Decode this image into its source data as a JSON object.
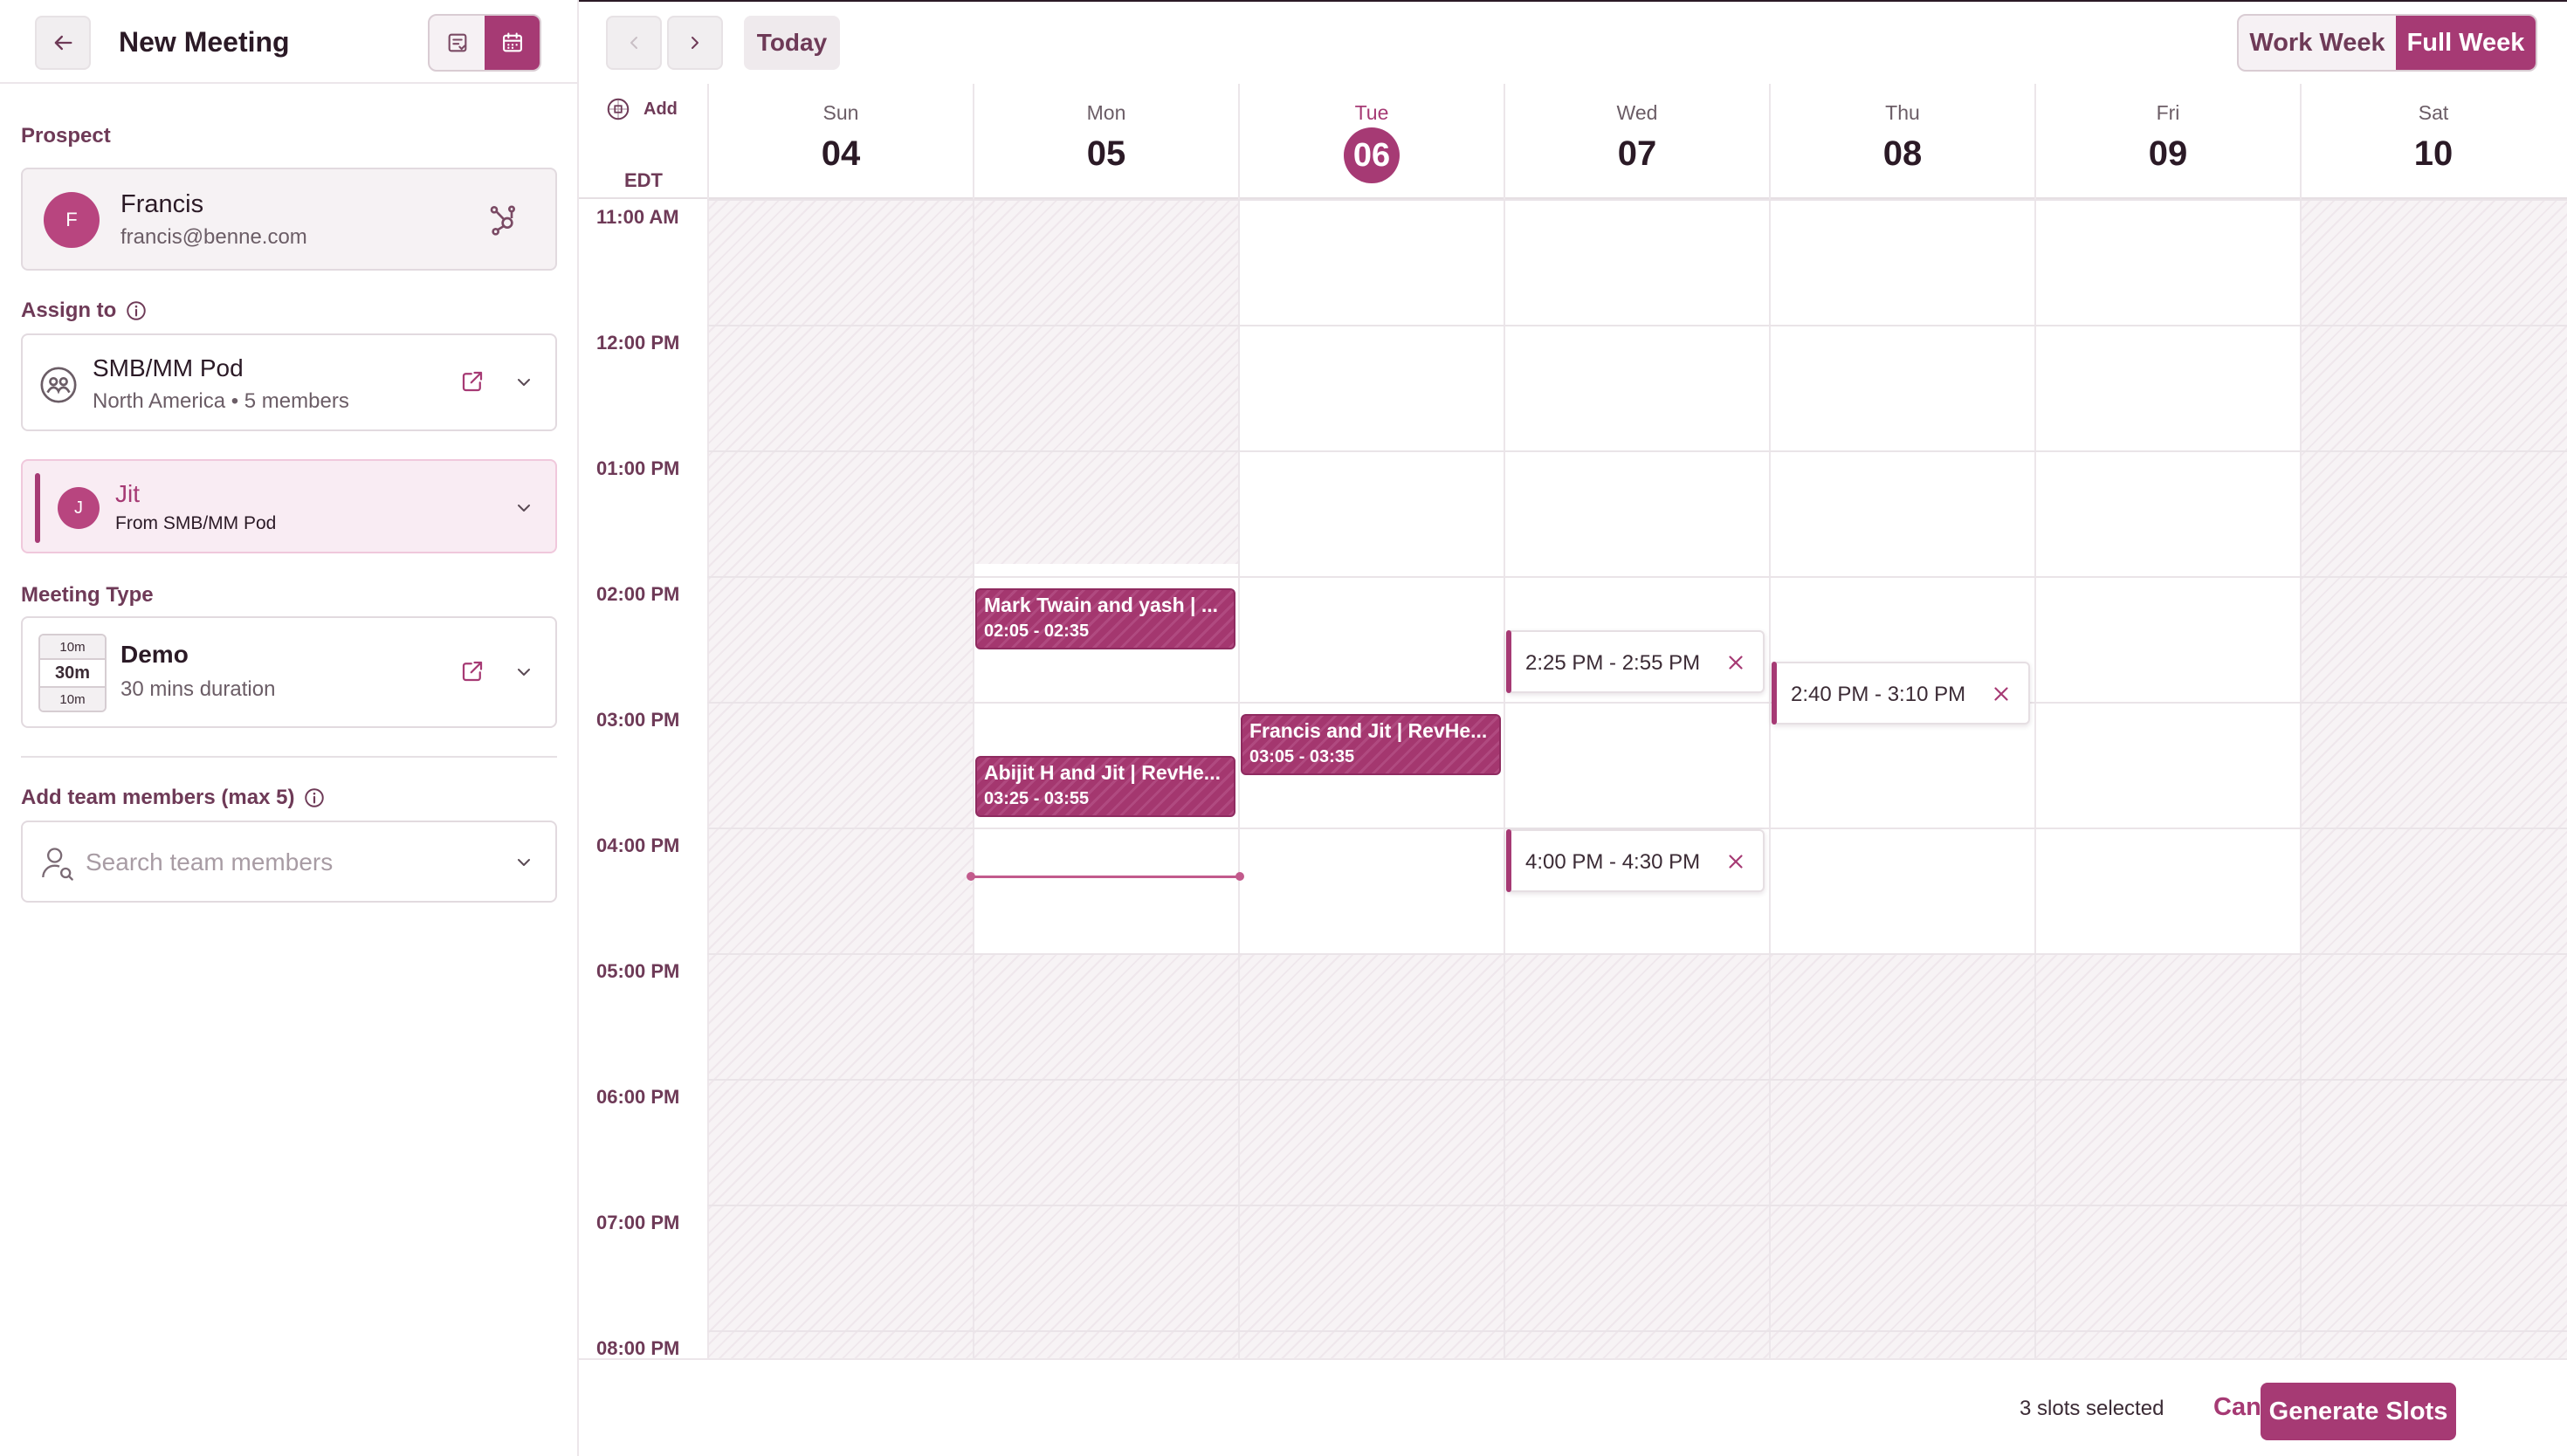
{
  "left_panel": {
    "title": "New Meeting",
    "prospect": {
      "label": "Prospect",
      "initial": "F",
      "name": "Francis",
      "email": "francis@benne.com"
    },
    "assign": {
      "label": "Assign to",
      "pod_name": "SMB/MM Pod",
      "pod_sub": "North America • 5 members"
    },
    "assignee": {
      "initial": "J",
      "name": "Jit",
      "sub": "From SMB/MM Pod"
    },
    "meeting_type": {
      "label": "Meeting Type",
      "buffer_before": "10m",
      "duration": "30m",
      "buffer_after": "10m",
      "name": "Demo",
      "sub": "30 mins duration"
    },
    "team": {
      "label": "Add team members (max 5)",
      "placeholder": "Search team members"
    }
  },
  "toolbar": {
    "today": "Today",
    "work_week": "Work Week",
    "full_week": "Full Week"
  },
  "calendar": {
    "add_label": "Add",
    "timezone": "EDT",
    "days": [
      {
        "name": "Sun",
        "num": "04"
      },
      {
        "name": "Mon",
        "num": "05"
      },
      {
        "name": "Tue",
        "num": "06"
      },
      {
        "name": "Wed",
        "num": "07"
      },
      {
        "name": "Thu",
        "num": "08"
      },
      {
        "name": "Fri",
        "num": "09"
      },
      {
        "name": "Sat",
        "num": "10"
      }
    ],
    "times": [
      "11:00 AM",
      "12:00 PM",
      "01:00 PM",
      "02:00 PM",
      "03:00 PM",
      "04:00 PM",
      "05:00 PM",
      "06:00 PM",
      "07:00 PM",
      "08:00 PM"
    ],
    "events": [
      {
        "title": "Mark Twain and yash | ...",
        "time": "02:05 - 02:35",
        "day": "Mon"
      },
      {
        "title": "Abijit H and Jit | RevHe...",
        "time": "03:25 - 03:55",
        "day": "Mon"
      },
      {
        "title": "Francis and Jit | RevHe...",
        "time": "03:05 - 03:35",
        "day": "Tue"
      }
    ],
    "slots": [
      {
        "text": "2:25 PM - 2:55 PM",
        "day": "Wed"
      },
      {
        "text": "2:40 PM - 3:10 PM",
        "day": "Thu"
      },
      {
        "text": "4:00 PM - 4:30 PM",
        "day": "Wed"
      }
    ]
  },
  "footer": {
    "slots_selected": "3 slots selected",
    "cancel": "Cancel",
    "generate": "Generate Slots"
  },
  "colors": {
    "accent": "#a63a74",
    "accent_soft": "#f9ecf3"
  }
}
